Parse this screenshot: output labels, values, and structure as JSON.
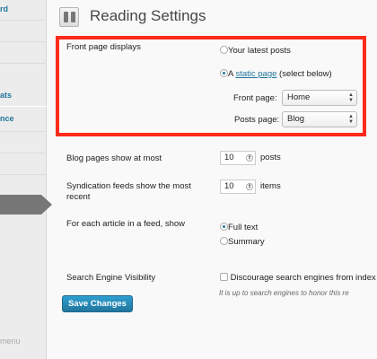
{
  "sidebar": {
    "items": [
      "rd",
      "ats",
      "nce"
    ],
    "collapse_label": "menu"
  },
  "page": {
    "title": "Reading Settings"
  },
  "front_page": {
    "label": "Front page displays",
    "option_latest": "Your latest posts",
    "option_static_prefix": "A ",
    "option_static_link": "static page",
    "option_static_suffix": " (select below)",
    "selected": "static",
    "front_page_label": "Front page:",
    "front_page_value": "Home",
    "posts_page_label": "Posts page:",
    "posts_page_value": "Blog"
  },
  "blog_pages": {
    "label": "Blog pages show at most",
    "value": "10",
    "unit": "posts"
  },
  "feeds": {
    "label": "Syndication feeds show the most recent",
    "value": "10",
    "unit": "items"
  },
  "article_feed": {
    "label": "For each article in a feed, show",
    "option_full": "Full text",
    "option_summary": "Summary",
    "selected": "full"
  },
  "search": {
    "label": "Search Engine Visibility",
    "checkbox_label": "Discourage search engines from index",
    "description": "It is up to search engines to honor this re",
    "checked": false
  },
  "save_label": "Save Changes",
  "colors": {
    "accent": "#21759b",
    "highlight": "#ff2b1a"
  }
}
